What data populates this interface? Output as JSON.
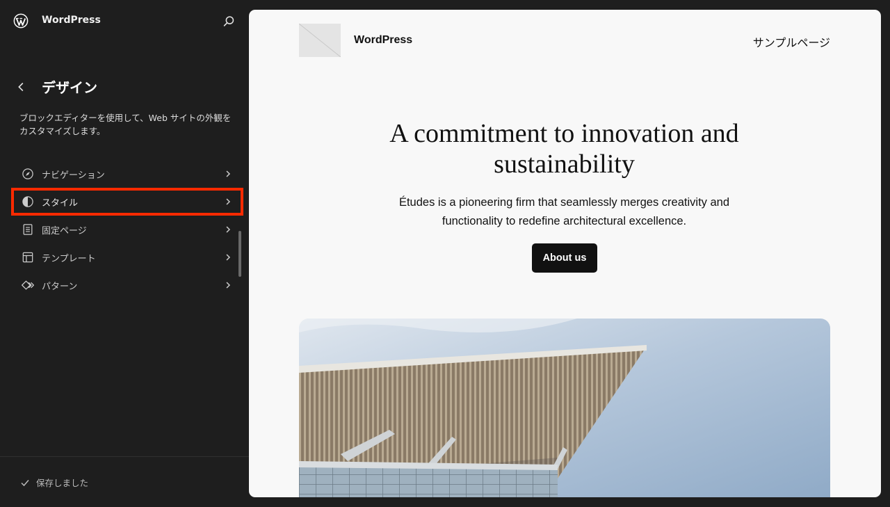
{
  "app": {
    "site_name": "WordPress"
  },
  "sidebar": {
    "back_title": "デザイン",
    "description": "ブロックエディターを使用して、Web サイトの外観をカスタマイズします。",
    "items": [
      {
        "label": "ナビゲーション",
        "icon": "navigation-icon"
      },
      {
        "label": "スタイル",
        "icon": "styles-icon",
        "highlighted": true
      },
      {
        "label": "固定ページ",
        "icon": "page-icon"
      },
      {
        "label": "テンプレート",
        "icon": "template-icon"
      },
      {
        "label": "パターン",
        "icon": "pattern-icon"
      }
    ],
    "save_status": "保存しました"
  },
  "preview": {
    "site_title": "WordPress",
    "nav_link": "サンプルページ",
    "hero_title": "A commitment to innovation and sustainability",
    "hero_text": "Études is a pioneering firm that seamlessly merges creativity and functionality to redefine architectural excellence.",
    "button_label": "About us"
  },
  "colors": {
    "highlight": "#ff2a00",
    "sidebar_bg": "#1e1e1e",
    "canvas_bg": "#f8f8f8"
  }
}
